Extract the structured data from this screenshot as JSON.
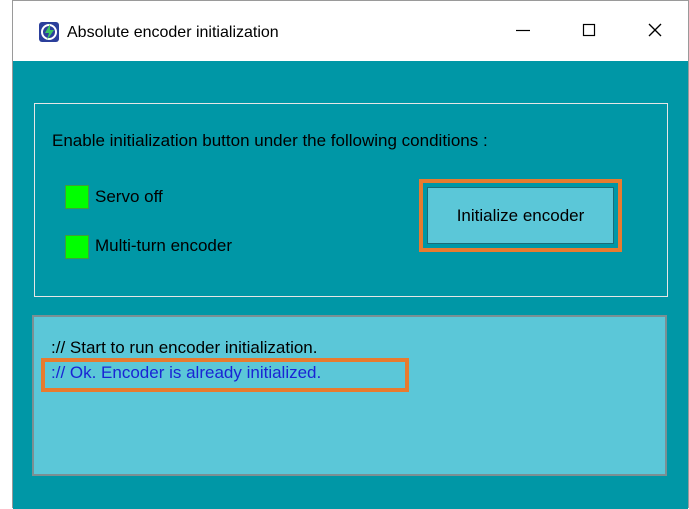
{
  "window": {
    "title": "Absolute encoder initialization",
    "icon": "app-logo-icon",
    "controls": {
      "minimize_icon": "minimize-icon",
      "maximize_icon": "maximize-icon",
      "close_icon": "close-icon"
    }
  },
  "conditions_panel": {
    "instruction": "Enable initialization button under the following conditions :",
    "conditions": [
      {
        "label": "Servo off",
        "indicator_color": "#00ff00"
      },
      {
        "label": "Multi-turn encoder",
        "indicator_color": "#00ff00"
      }
    ],
    "initialize_button_label": "Initialize encoder"
  },
  "log": {
    "lines": [
      {
        "text": ":// Start to run encoder initialization.",
        "color": "#000000"
      },
      {
        "text": ":// Ok. Encoder is already initialized.",
        "color": "#1a24d4"
      }
    ]
  },
  "colors": {
    "client_background": "#0097a6",
    "button_background": "#5bc7d8",
    "log_background": "#5bc7d8",
    "highlight": "#e87b2f"
  }
}
